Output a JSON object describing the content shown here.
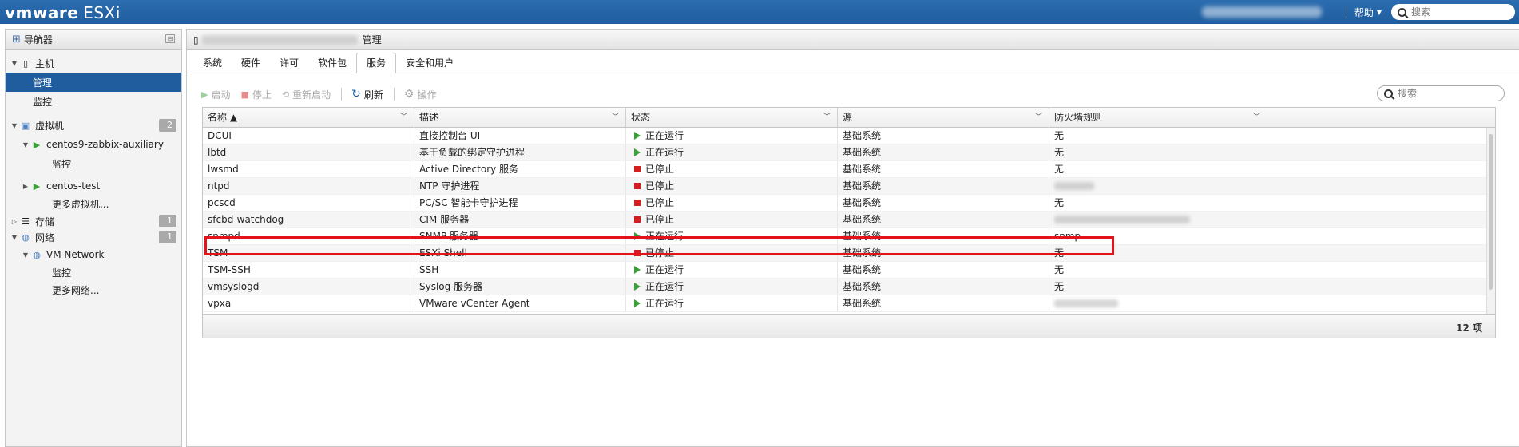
{
  "app": {
    "logo_brand": "vmware",
    "logo_product": "ESXi"
  },
  "top": {
    "help_label": "帮助",
    "search_placeholder": "搜索"
  },
  "navigator": {
    "title": "导航器",
    "items": [
      {
        "label": "主机",
        "badge": ""
      },
      {
        "label": "管理",
        "badge": ""
      },
      {
        "label": "监控",
        "badge": ""
      },
      {
        "label": "虚拟机",
        "badge": "2"
      },
      {
        "label": "centos9-zabbix-auxiliary",
        "badge": ""
      },
      {
        "label": "监控",
        "badge": ""
      },
      {
        "label": "centos-test",
        "badge": ""
      },
      {
        "label": "更多虚拟机...",
        "badge": ""
      },
      {
        "label": "存储",
        "badge": "1"
      },
      {
        "label": "网络",
        "badge": "1"
      },
      {
        "label": "VM Network",
        "badge": ""
      },
      {
        "label": "监控",
        "badge": ""
      },
      {
        "label": "更多网络...",
        "badge": ""
      }
    ]
  },
  "main": {
    "title_suffix": "管理",
    "tabs": [
      "系统",
      "硬件",
      "许可",
      "软件包",
      "服务",
      "安全和用户"
    ],
    "active_tab": "服务",
    "toolbar": {
      "start": "启动",
      "stop": "停止",
      "restart": "重新启动",
      "refresh": "刷新",
      "actions": "操作"
    },
    "search_placeholder": "搜索"
  },
  "services": {
    "columns": [
      "名称 ▲",
      "描述",
      "状态",
      "源",
      "防火墙规则"
    ],
    "rows": [
      {
        "name": "DCUI",
        "desc": "直接控制台 UI",
        "state": "正在运行",
        "running": true,
        "source": "基础系统",
        "fw": "无"
      },
      {
        "name": "lbtd",
        "desc": "基于负载的绑定守护进程",
        "state": "正在运行",
        "running": true,
        "source": "基础系统",
        "fw": "无"
      },
      {
        "name": "lwsmd",
        "desc": "Active Directory 服务",
        "state": "已停止",
        "running": false,
        "source": "基础系统",
        "fw": "无"
      },
      {
        "name": "ntpd",
        "desc": "NTP 守护进程",
        "state": "已停止",
        "running": false,
        "source": "基础系统",
        "fw": ""
      },
      {
        "name": "pcscd",
        "desc": "PC/SC 智能卡守护进程",
        "state": "已停止",
        "running": false,
        "source": "基础系统",
        "fw": "无"
      },
      {
        "name": "sfcbd-watchdog",
        "desc": "CIM 服务器",
        "state": "已停止",
        "running": false,
        "source": "基础系统",
        "fw": ""
      },
      {
        "name": "snmpd",
        "desc": "SNMP 服务器",
        "state": "正在运行",
        "running": true,
        "source": "基础系统",
        "fw": "snmp"
      },
      {
        "name": "TSM",
        "desc": "ESXi Shell",
        "state": "已停止",
        "running": false,
        "source": "基础系统",
        "fw": "无"
      },
      {
        "name": "TSM-SSH",
        "desc": "SSH",
        "state": "正在运行",
        "running": true,
        "source": "基础系统",
        "fw": "无"
      },
      {
        "name": "vmsyslogd",
        "desc": "Syslog 服务器",
        "state": "正在运行",
        "running": true,
        "source": "基础系统",
        "fw": "无"
      },
      {
        "name": "vpxa",
        "desc": "VMware vCenter Agent",
        "state": "正在运行",
        "running": true,
        "source": "基础系统",
        "fw": ""
      }
    ],
    "count_label": "12 项"
  },
  "colors": {
    "topbar": "#1f5d9e",
    "selected": "#1f5d9e",
    "running": "#3aa13a",
    "stopped": "#d31f1f",
    "highlight": "#e3121b"
  }
}
